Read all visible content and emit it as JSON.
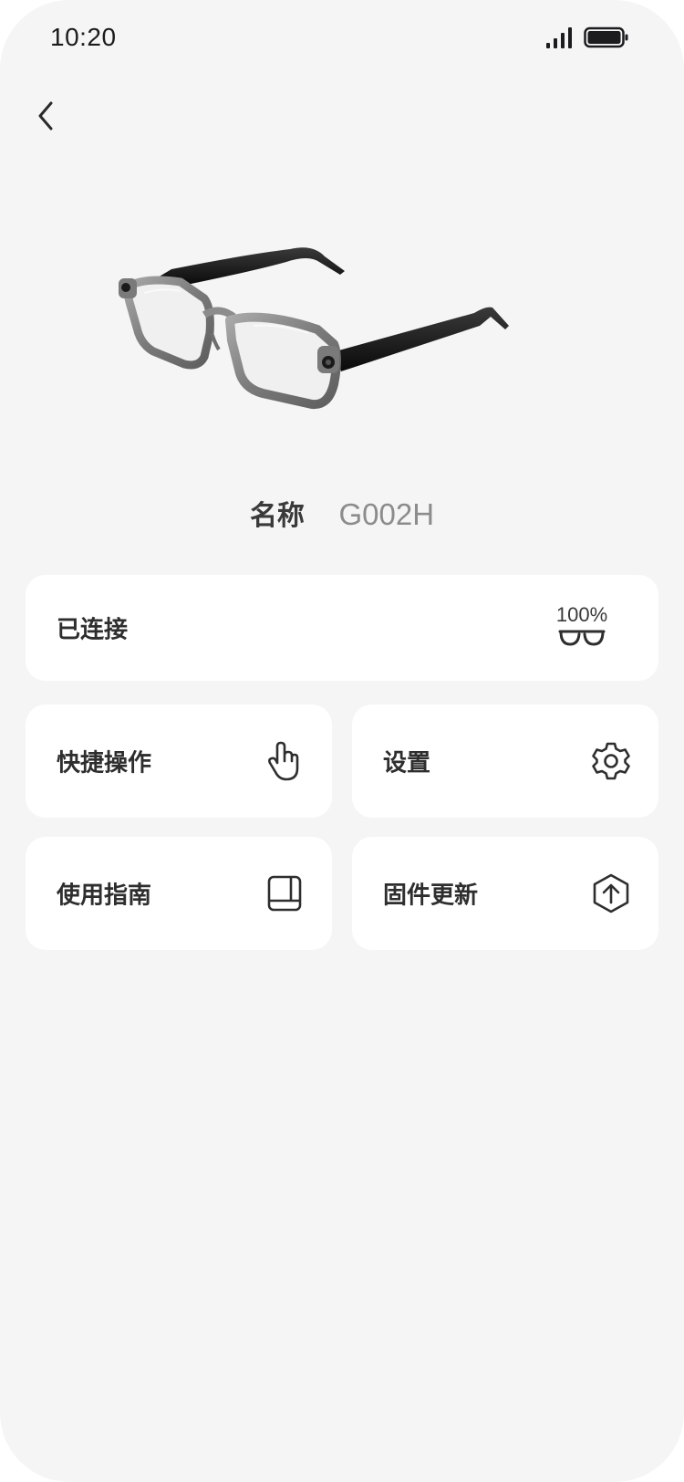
{
  "status_bar": {
    "time": "10:20",
    "signal_icon": "cellular-signal-icon",
    "battery_icon": "battery-icon",
    "battery_level": 1.0
  },
  "header": {
    "back_icon": "chevron-left-icon"
  },
  "device": {
    "image": "smart-glasses-image",
    "name_label": "名称",
    "name_value": "G002H"
  },
  "connection": {
    "status": "已连接",
    "battery_percent": "100%",
    "glasses_icon": "glasses-icon"
  },
  "menu": [
    {
      "label": "快捷操作",
      "icon": "touch-gesture-icon"
    },
    {
      "label": "设置",
      "icon": "gear-icon"
    },
    {
      "label": "使用指南",
      "icon": "book-icon"
    },
    {
      "label": "固件更新",
      "icon": "upload-arrow-icon"
    }
  ],
  "colors": {
    "background": "#f5f5f5",
    "card": "#ffffff",
    "text_primary": "#2e2e2e",
    "text_secondary": "#8c8c8c"
  }
}
